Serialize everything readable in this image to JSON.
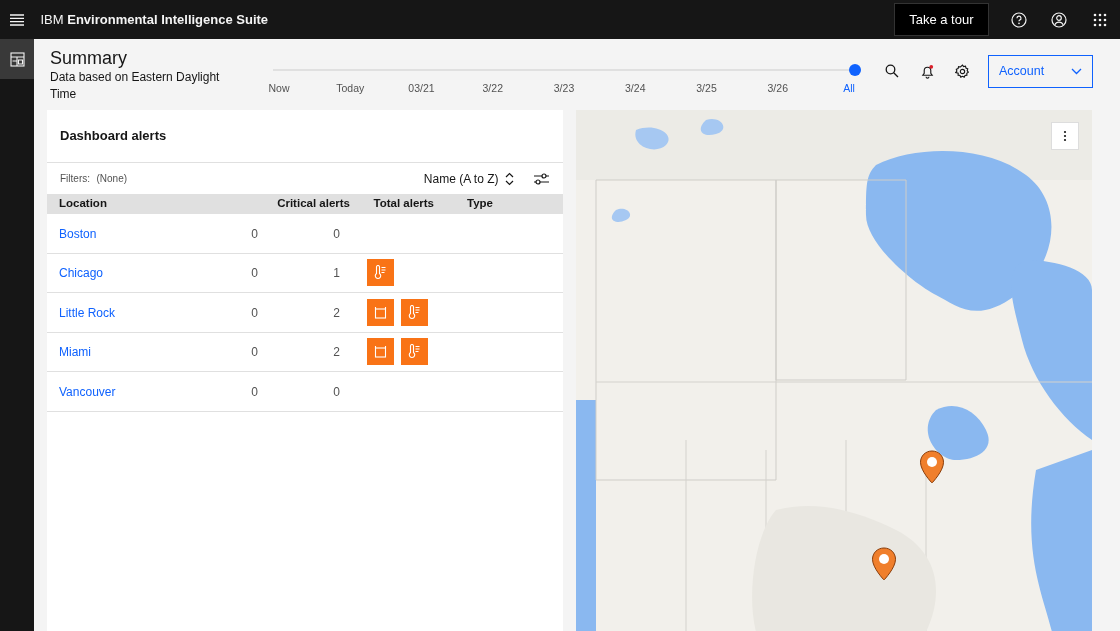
{
  "header": {
    "brand_prefix": "IBM",
    "brand_name": "Environmental Intelligence Suite",
    "tour_button": "Take a tour"
  },
  "page": {
    "title": "Summary",
    "subtitle": "Data based on Eastern Daylight Time"
  },
  "timeline": [
    {
      "label": "Now",
      "selected": false
    },
    {
      "label": "Today",
      "selected": false
    },
    {
      "label": "03/21",
      "selected": false
    },
    {
      "label": "3/22",
      "selected": false
    },
    {
      "label": "3/23",
      "selected": false
    },
    {
      "label": "3/24",
      "selected": false
    },
    {
      "label": "3/25",
      "selected": false
    },
    {
      "label": "3/26",
      "selected": false
    },
    {
      "label": "All",
      "selected": true
    }
  ],
  "toolbar": {
    "notification_unread": true,
    "account_button": "Account"
  },
  "alerts": {
    "title": "Dashboard alerts",
    "filters_label": "Filters:",
    "filters_value": "(None)",
    "sort": "Name (A to Z)",
    "columns": [
      "Location",
      "Critical alerts",
      "Total alerts",
      "Type"
    ],
    "rows": [
      {
        "location": "Boston",
        "critical": "0",
        "total": "0",
        "types": []
      },
      {
        "location": "Chicago",
        "critical": "0",
        "total": "1",
        "types": [
          {
            "kind": "thermometer"
          }
        ]
      },
      {
        "location": "Little Rock",
        "critical": "0",
        "total": "2",
        "types": [
          {
            "kind": "frame"
          },
          {
            "kind": "thermometer"
          }
        ]
      },
      {
        "location": "Miami",
        "critical": "0",
        "total": "2",
        "types": [
          {
            "kind": "frame"
          },
          {
            "kind": "thermometer"
          }
        ]
      },
      {
        "location": "Vancouver",
        "critical": "0",
        "total": "0",
        "types": []
      }
    ]
  }
}
